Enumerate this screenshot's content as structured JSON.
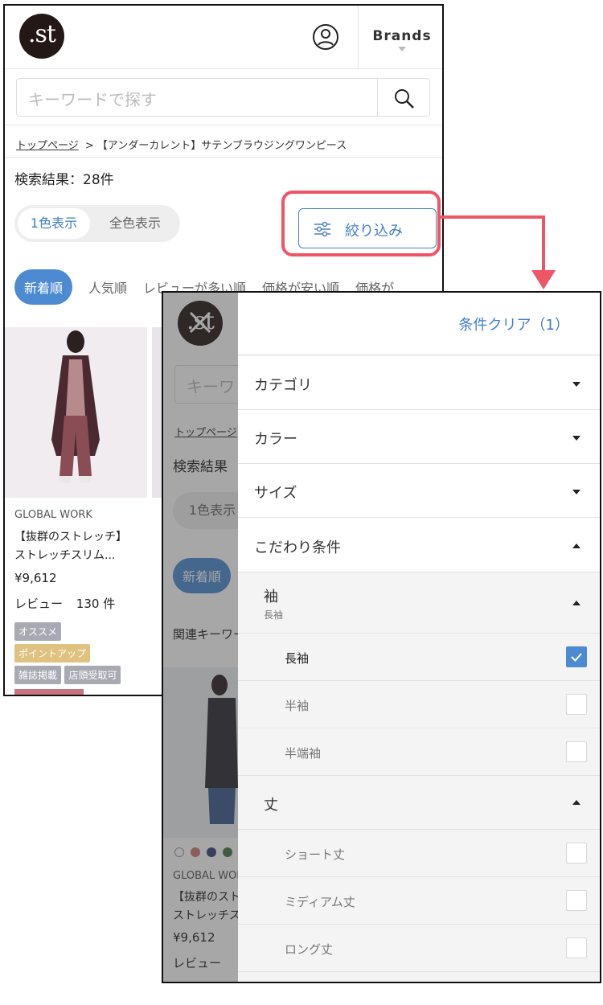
{
  "left_screen": {
    "logo": ".st",
    "brands_label": "Brands",
    "search_placeholder": "キーワードで探す",
    "breadcrumb_home": "トップページ",
    "breadcrumb_sep": ">",
    "breadcrumb_current": "【アンダーカレント】サテンブラウジングワンピース",
    "result_count": "検索結果：28件",
    "toggle_single": "1色表示",
    "toggle_all": "全色表示",
    "filter_button": "絞り込み",
    "sort_options": [
      "新着順",
      "人気順",
      "レビューが多い順",
      "価格が安い順",
      "価格が"
    ],
    "product": {
      "brand": "GLOBAL WORK",
      "name_line1": "【抜群のストレッチ】",
      "name_line2": "ストレッチスリム...",
      "price": "¥9,612",
      "review_label": "レビュー",
      "review_count": "130 件",
      "tags": [
        "オススメ",
        "ポイントアップ",
        "雑誌掲載",
        "店頭受取可"
      ]
    }
  },
  "right_screen": {
    "clear_label": "条件クリア（1）",
    "bg": {
      "search_fragment": "キーワ",
      "crumb_fragment": "トップページ",
      "count_fragment": "検索結果",
      "toggle_fragment": "1色表示",
      "sort_fragment": "新着順",
      "related_fragment": "関連キーワード",
      "brand_fragment": "GLOBAL WORK",
      "name1_fragment": "【抜群のスト",
      "name2_fragment": "ストレッチス",
      "price": "¥9,612",
      "review_fragment": "レビュー"
    },
    "categories": [
      "カテゴリ",
      "カラー",
      "サイズ",
      "こだわり条件"
    ],
    "sleeve": {
      "title": "袖",
      "selected": "長袖"
    },
    "sleeve_options": [
      {
        "label": "長袖",
        "checked": true
      },
      {
        "label": "半袖",
        "checked": false
      },
      {
        "label": "半端袖",
        "checked": false
      }
    ],
    "length": {
      "title": "丈"
    },
    "length_options": [
      {
        "label": "ショート丈",
        "checked": false
      },
      {
        "label": "ミディアム丈",
        "checked": false
      },
      {
        "label": "ロング丈",
        "checked": false
      }
    ]
  },
  "colors": {
    "accent": "#4c8bd1",
    "callout": "#ee5566",
    "tag_gray": "#a9a9b3",
    "tag_gold": "#dfc27f"
  }
}
